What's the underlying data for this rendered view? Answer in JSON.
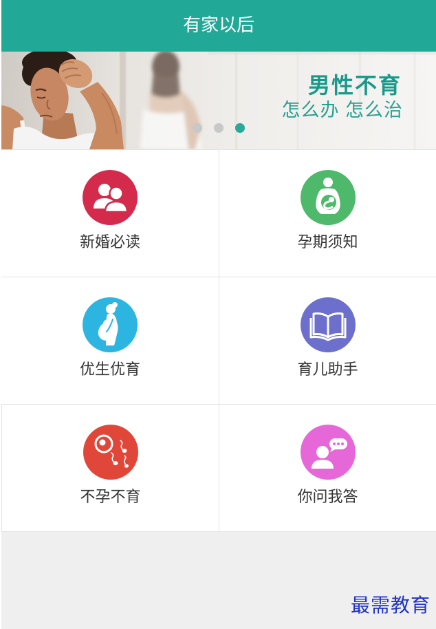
{
  "header": {
    "title": "有家以后"
  },
  "banner": {
    "headline": "男性不育",
    "subline": "怎么办 怎么治",
    "slide_count": 3,
    "active_slide": 3
  },
  "menu": [
    {
      "label": "新婚必读",
      "icon": "couple-icon",
      "color": "#d42b4d"
    },
    {
      "label": "孕期须知",
      "icon": "pregnant-baby-icon",
      "color": "#4fb96b"
    },
    {
      "label": "优生优育",
      "icon": "pregnant-silhouette-icon",
      "color": "#2bb5e0"
    },
    {
      "label": "育儿助手",
      "icon": "open-book-icon",
      "color": "#6c6fcc"
    },
    {
      "label": "不孕不育",
      "icon": "sperm-egg-icon",
      "color": "#e04739"
    },
    {
      "label": "你问我答",
      "icon": "chat-person-icon",
      "color": "#e667d8"
    }
  ],
  "theme": {
    "accent": "#22a897",
    "banner_text": "#1a998a",
    "dot_active": "#2aa99a",
    "dot_inactive": "#c8c8c8",
    "label_text": "#333333",
    "page_background": "#efefef",
    "watermark_text": "#1f33c4"
  },
  "watermark": "最需教育"
}
